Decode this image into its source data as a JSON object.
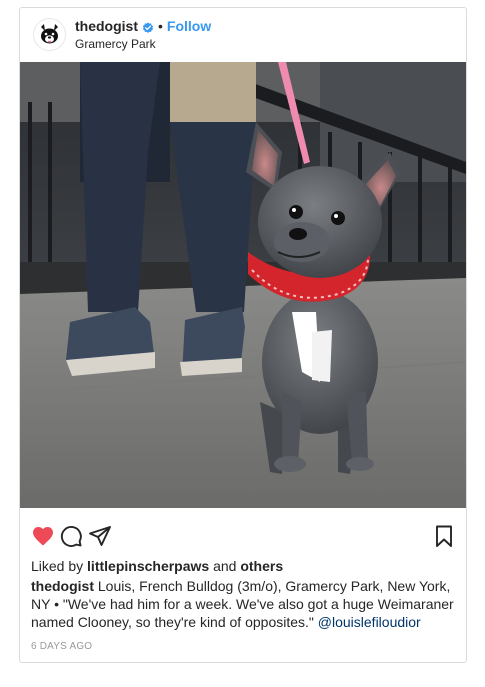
{
  "header": {
    "username": "thedogist",
    "separator": "•",
    "follow_label": "Follow",
    "location": "Gramercy Park",
    "verified_icon": "verified-badge-icon",
    "avatar_icon": "dog-face-icon"
  },
  "photo": {
    "subject_icon": "french-bulldog-photo"
  },
  "actions": {
    "like_icon": "heart-filled-icon",
    "comment_icon": "comment-icon",
    "share_icon": "paper-plane-icon",
    "save_icon": "bookmark-icon",
    "like_color": "#ed4956"
  },
  "likes": {
    "prefix": "Liked by",
    "user": "littlepinscherpaws",
    "joiner": "and",
    "others": "others"
  },
  "caption": {
    "username": "thedogist",
    "text": "Louis, French Bulldog (3m/o), Gramercy Park, New York, NY • \"We've had him for a week. We've also got a huge Weimaraner named Clooney, so they're kind of opposites.\"",
    "mention": "@louislefiloudior"
  },
  "timestamp": "6 DAYS AGO",
  "colors": {
    "accent": "#3897f0",
    "mention": "#003569",
    "muted": "#999999",
    "border": "#dbdbdb"
  }
}
